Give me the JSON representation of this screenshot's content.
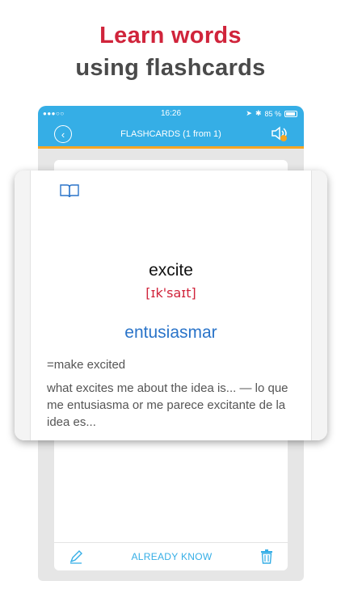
{
  "headline": {
    "line1": "Learn words",
    "line2": "using flashcards"
  },
  "status_bar": {
    "signal": "●●●○○",
    "time": "16:26",
    "battery": "85 %"
  },
  "nav": {
    "title": "FLASHCARDS  (1 from 1)"
  },
  "card": {
    "word": "excite",
    "transcription": "[ɪk'saɪt]",
    "translation": "entusiasmar",
    "definition": "=make excited",
    "example": "what excites me about the idea is... — lo que me entusiasma or me parece excitante de la idea es...",
    "cut_line": "- - - - - - - - - - - - - - - - - - - - - - - - -"
  },
  "bottom": {
    "know_label": "ALREADY KNOW"
  },
  "colors": {
    "accent": "#35aee6",
    "brand_red": "#d0243b",
    "translation_blue": "#2a74c9",
    "orange": "#f5a623"
  }
}
